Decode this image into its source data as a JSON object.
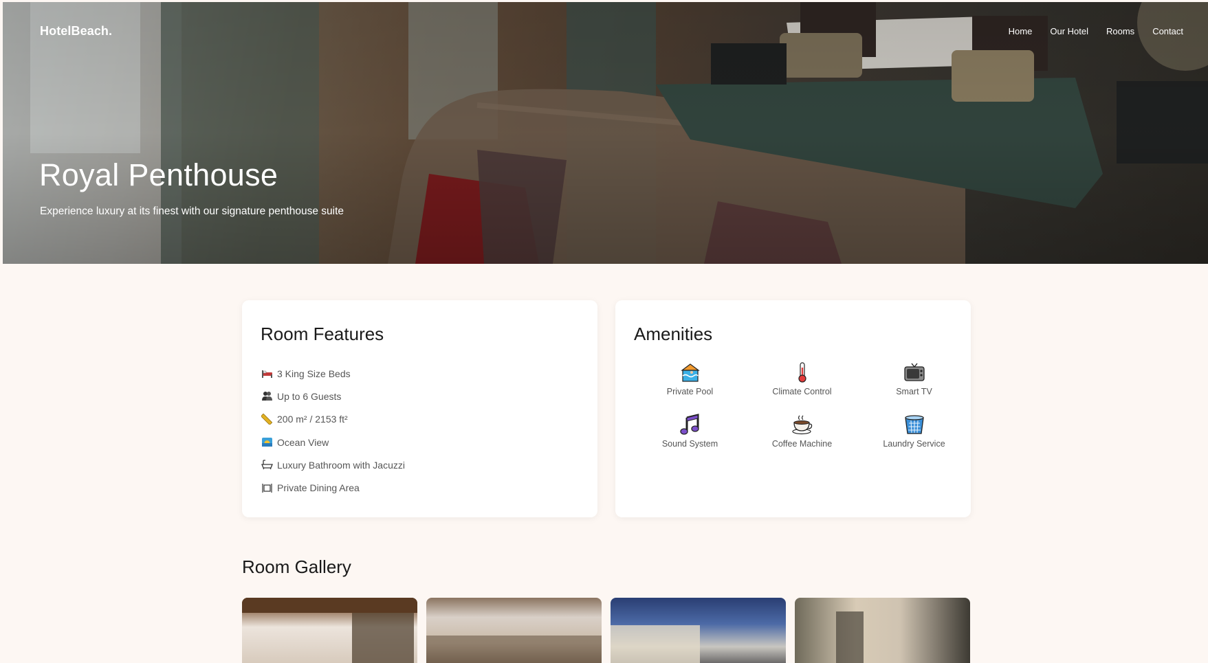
{
  "brand": "HotelBeach.",
  "nav": [
    "Home",
    "Our Hotel",
    "Rooms",
    "Contact"
  ],
  "hero": {
    "title": "Royal Penthouse",
    "subtitle": "Experience luxury at its finest with our signature penthouse suite"
  },
  "features": {
    "heading": "Room Features",
    "items": [
      {
        "icon": "bed-icon",
        "label": "3 King Size Beds"
      },
      {
        "icon": "guests-icon",
        "label": "Up to 6 Guests"
      },
      {
        "icon": "ruler-icon",
        "label": "200 m² / 2153 ft²"
      },
      {
        "icon": "sunrise-icon",
        "label": "Ocean View"
      },
      {
        "icon": "bathtub-icon",
        "label": "Luxury Bathroom with Jacuzzi"
      },
      {
        "icon": "dining-icon",
        "label": "Private Dining Area"
      }
    ]
  },
  "amenities": {
    "heading": "Amenities",
    "items": [
      {
        "icon": "pool-icon",
        "label": "Private Pool"
      },
      {
        "icon": "thermometer-icon",
        "label": "Climate Control"
      },
      {
        "icon": "tv-icon",
        "label": "Smart TV"
      },
      {
        "icon": "music-icon",
        "label": "Sound System"
      },
      {
        "icon": "coffee-icon",
        "label": "Coffee Machine"
      },
      {
        "icon": "laundry-icon",
        "label": "Laundry Service"
      }
    ]
  },
  "gallery": {
    "heading": "Room Gallery"
  }
}
